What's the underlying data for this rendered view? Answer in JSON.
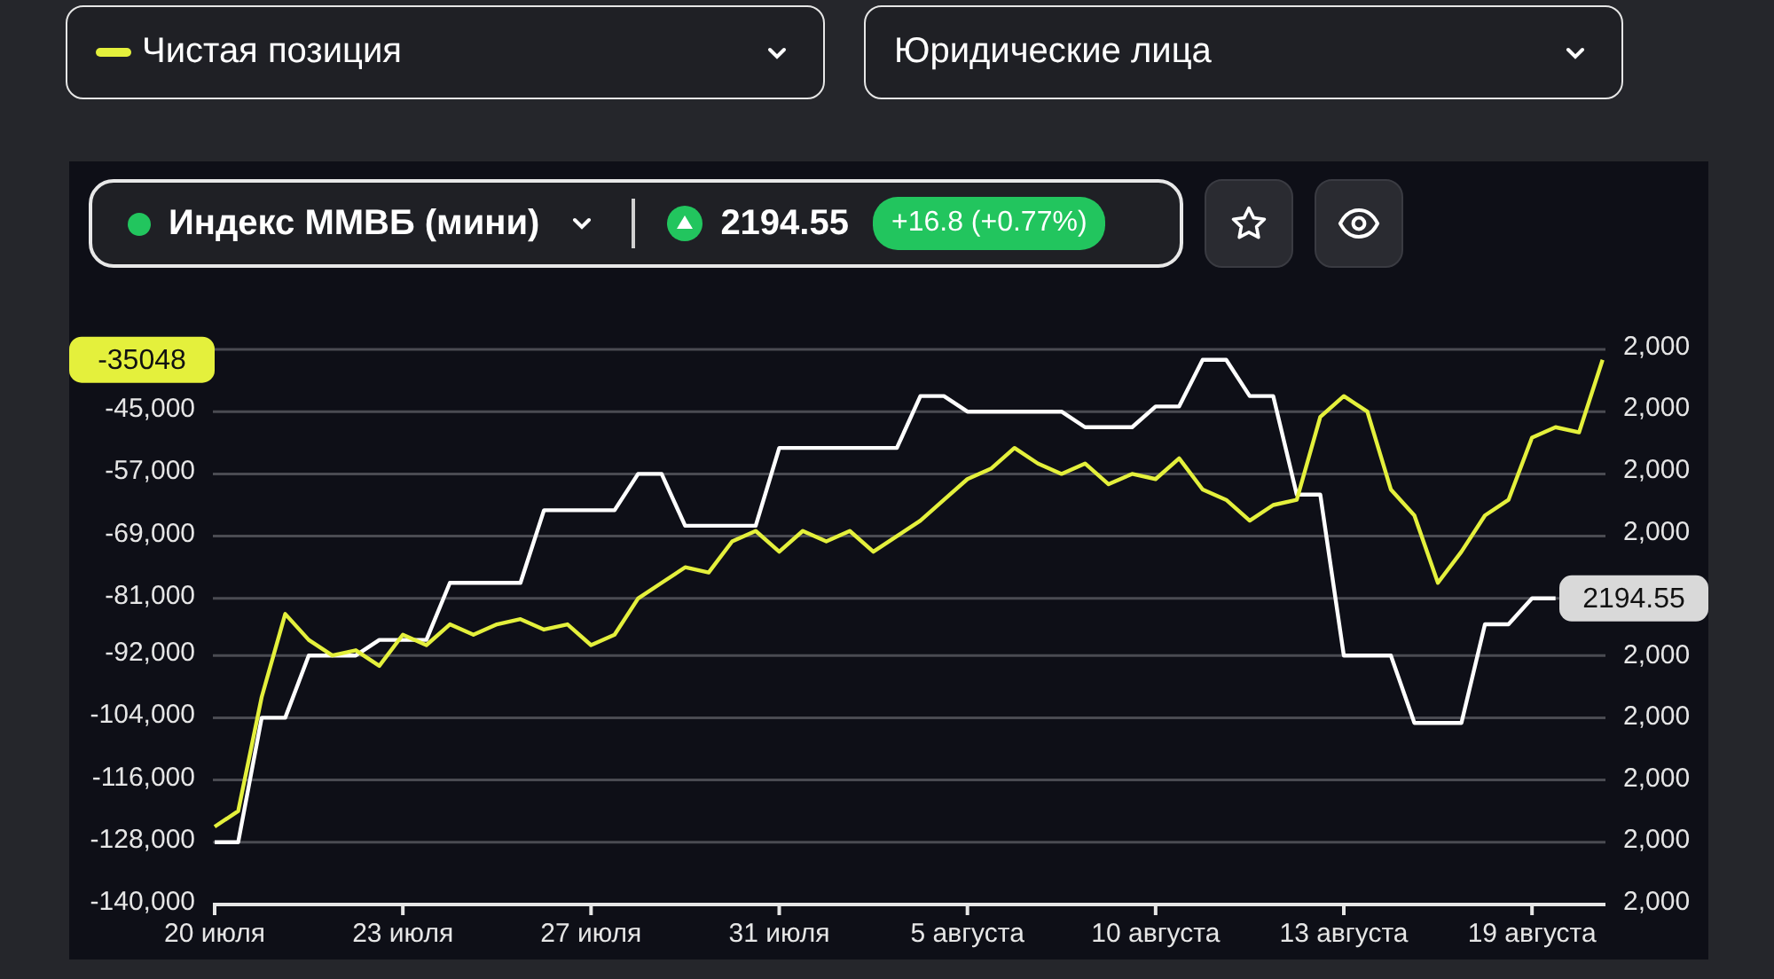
{
  "selectors": [
    {
      "label": "Чистая позиция"
    },
    {
      "label": "Юридические лица"
    }
  ],
  "instrument": {
    "name": "Индекс ММВБ (мини)",
    "price": "2194.55",
    "change": "+16.8 (+0.77%)"
  },
  "chart": {
    "left_last_label": "-35048",
    "right_last_label": "2194.55",
    "right_ticks": [
      "2,000",
      "2,000",
      "2,000",
      "2,000",
      "2,000",
      "2,000",
      "2,000",
      "2,000",
      "2,000"
    ],
    "chart_data": {
      "type": "line",
      "categories": [
        "20 июля",
        null,
        null,
        null,
        null,
        null,
        null,
        null,
        "23 июля",
        null,
        null,
        null,
        null,
        null,
        null,
        null,
        "27 июля",
        null,
        null,
        null,
        null,
        null,
        null,
        null,
        "31 июля",
        null,
        null,
        null,
        null,
        null,
        null,
        null,
        "5 августа",
        null,
        null,
        null,
        null,
        null,
        null,
        null,
        "10 августа",
        null,
        null,
        null,
        null,
        null,
        null,
        null,
        "13 августа",
        null,
        null,
        null,
        null,
        null,
        null,
        null,
        "19 августа",
        null,
        null,
        null
      ],
      "series": [
        {
          "color": "#e4f03c",
          "values": [
            -125000,
            -122000,
            -100000,
            -84000,
            -89000,
            -92000,
            -91000,
            -94000,
            -88000,
            -90000,
            -86000,
            -88000,
            -86000,
            -85000,
            -87000,
            -86000,
            -90000,
            -88000,
            -81000,
            -78000,
            -75000,
            -76000,
            -70000,
            -68000,
            -72000,
            -68000,
            -70000,
            -68000,
            -72000,
            -69000,
            -66000,
            -62000,
            -58000,
            -56000,
            -52000,
            -55000,
            -57000,
            -55000,
            -59000,
            -57000,
            -58000,
            -54000,
            -60000,
            -62000,
            -66000,
            -63000,
            -62000,
            -46000,
            -42000,
            -45000,
            -60000,
            -65000,
            -78000,
            -72000,
            -65000,
            -62000,
            -50000,
            -48000,
            -49000,
            -35000
          ]
        },
        {
          "color": "#ffffff",
          "values": [
            -128000,
            -128000,
            -104000,
            -104000,
            -92000,
            -92000,
            -92000,
            -89000,
            -89000,
            -89000,
            -78000,
            -78000,
            -78000,
            -78000,
            -64000,
            -64000,
            -64000,
            -64000,
            -57000,
            -57000,
            -67000,
            -67000,
            -67000,
            -67000,
            -52000,
            -52000,
            -52000,
            -52000,
            -52000,
            -52000,
            -42000,
            -42000,
            -45000,
            -45000,
            -45000,
            -45000,
            -45000,
            -48000,
            -48000,
            -48000,
            -44000,
            -44000,
            -35000,
            -35000,
            -42000,
            -42000,
            -61000,
            -61000,
            -92000,
            -92000,
            -92000,
            -105000,
            -105000,
            -105000,
            -86000,
            -86000,
            -81000,
            -81000,
            null,
            null
          ]
        }
      ],
      "ylim": [
        -140000,
        -33000
      ],
      "grid": true,
      "yticks": [
        {
          "value": -45000,
          "label": "-45,000"
        },
        {
          "value": -57000,
          "label": "-57,000"
        },
        {
          "value": -69000,
          "label": "-69,000"
        },
        {
          "value": -81000,
          "label": "-81,000"
        },
        {
          "value": -92000,
          "label": "-92,000"
        },
        {
          "value": -104000,
          "label": "-104,000"
        },
        {
          "value": -116000,
          "label": "-116,000"
        },
        {
          "value": -128000,
          "label": "-128,000"
        },
        {
          "value": -140000,
          "label": "-140,000"
        }
      ]
    }
  }
}
